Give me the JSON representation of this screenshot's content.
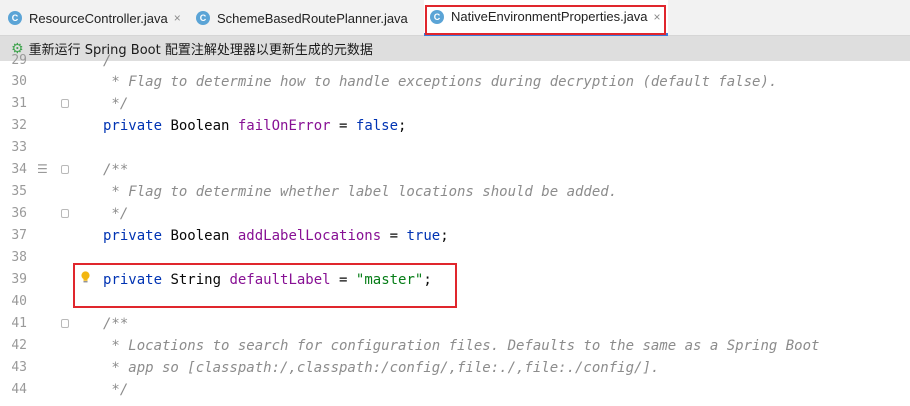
{
  "tabs": [
    {
      "label": "ResourceController.java",
      "icon": "java-class-icon",
      "close": "×"
    },
    {
      "label": "SchemeBasedRoutePlanner.java",
      "icon": "java-class-icon",
      "close": "×"
    },
    {
      "label": "NativeEnvironmentProperties.java",
      "icon": "java-class-icon",
      "close": "×",
      "active": true
    }
  ],
  "tab_icon_letter": "C",
  "notice": {
    "text": "重新运行 Spring Boot 配置注解处理器以更新生成的元数据",
    "icon": "spring-icon"
  },
  "code_lines": [
    {
      "num": "29",
      "text": "/"
    },
    {
      "num": "30",
      "text": " * Flag to determine how to handle exceptions during decryption (default false)."
    },
    {
      "num": "31",
      "text": " */"
    },
    {
      "num": "32",
      "text": "private Boolean failOnError = false;"
    },
    {
      "num": "33",
      "text": ""
    },
    {
      "num": "34",
      "text": "/**"
    },
    {
      "num": "35",
      "text": " * Flag to determine whether label locations should be added."
    },
    {
      "num": "36",
      "text": " */"
    },
    {
      "num": "37",
      "text": "private Boolean addLabelLocations = true;"
    },
    {
      "num": "38",
      "text": ""
    },
    {
      "num": "39",
      "text": "private String defaultLabel = \"master\";"
    },
    {
      "num": "40",
      "text": ""
    },
    {
      "num": "41",
      "text": "/**"
    },
    {
      "num": "42",
      "text": " * Locations to search for configuration files. Defaults to the same as a Spring Boot"
    },
    {
      "num": "43",
      "text": " * app so [classpath:/,classpath:/config/,file:./,file:./config/]."
    },
    {
      "num": "44",
      "text": " */"
    }
  ],
  "colors": {
    "keyword": "#0033b3",
    "field": "#871094",
    "string": "#067d17",
    "comment": "#8c8c8c",
    "highlight": "#e0262d"
  }
}
